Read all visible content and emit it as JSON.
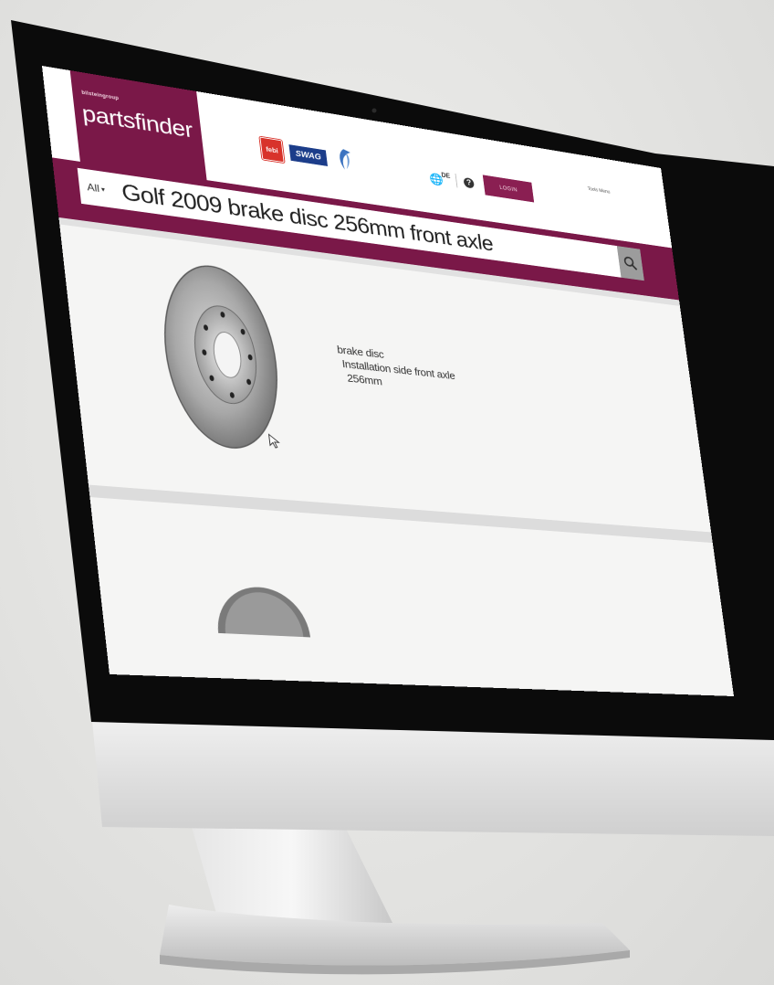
{
  "header": {
    "logo_small": "bilsteingroup",
    "logo_main": "partsfinder",
    "brands": [
      "febi",
      "SWAG",
      "bp"
    ],
    "language": "DE",
    "help_icon": "question-icon",
    "globe_icon": "globe-icon",
    "login_label": "LOGIN",
    "top_link": "Tools Menu"
  },
  "search": {
    "category": "All",
    "query": "Golf 2009 brake disc 256mm front axle",
    "search_icon": "magnifier-icon"
  },
  "results": [
    {
      "title": "brake disc",
      "line2": "Installation side front axle",
      "line3": "256mm"
    }
  ],
  "colors": {
    "brand": "#7a1848",
    "login": "#8a1f52",
    "swag": "#1c3d8a",
    "febi": "#d8332b"
  }
}
